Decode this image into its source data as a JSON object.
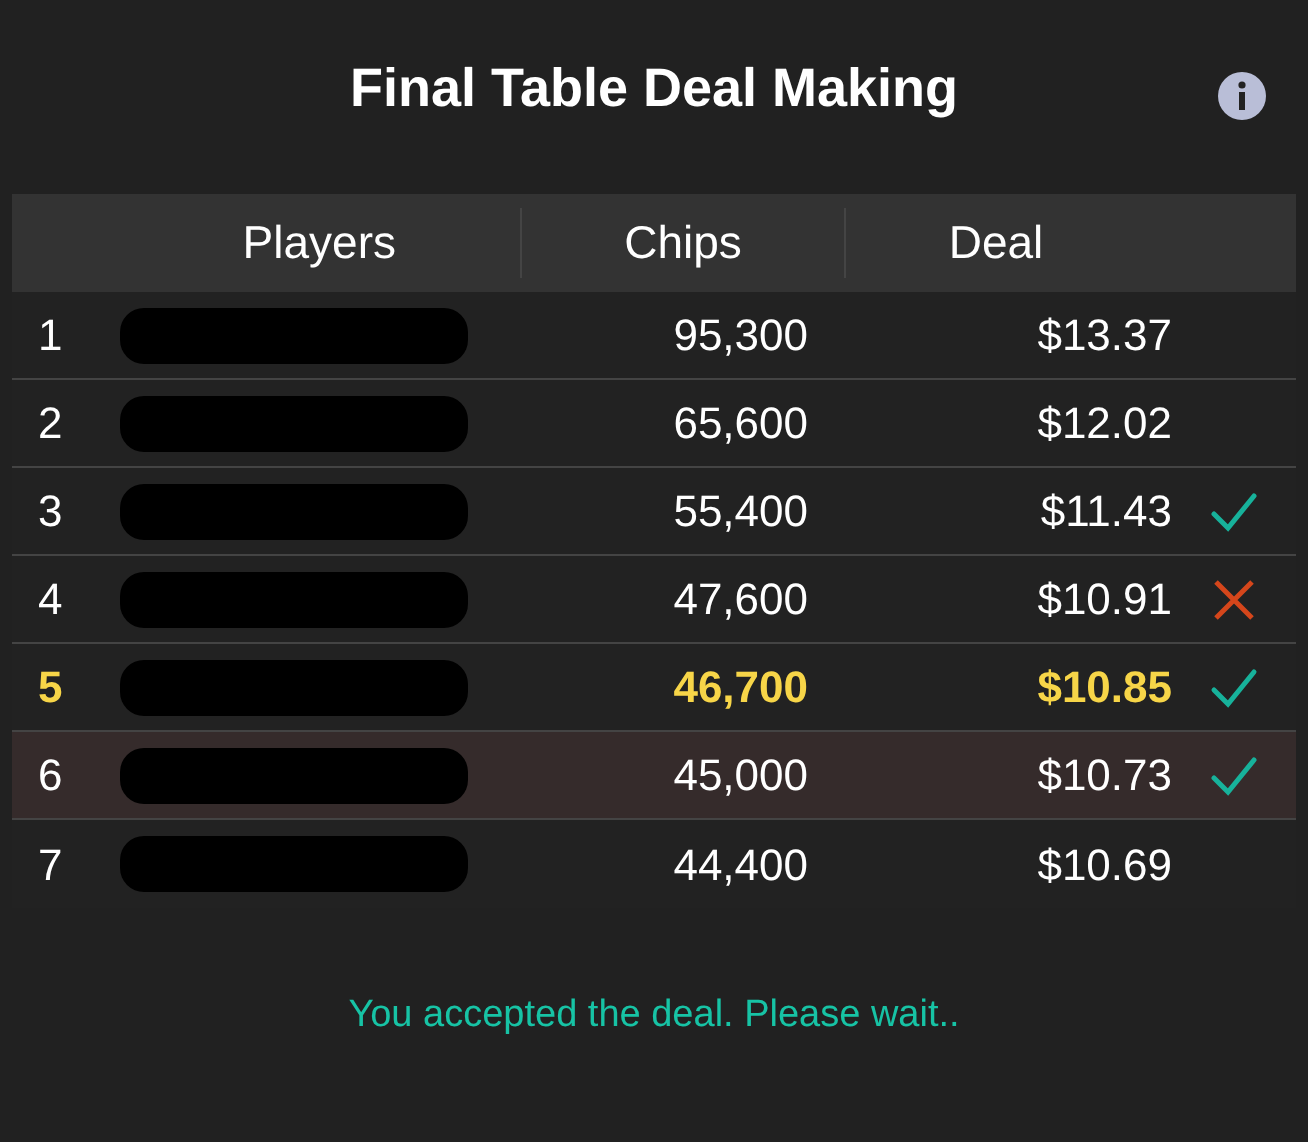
{
  "title": "Final Table Deal Making",
  "table": {
    "columns": [
      "Players",
      "Chips",
      "Deal"
    ],
    "rows": [
      {
        "rank": "1",
        "chips": "95,300",
        "deal": "$13.37",
        "accepted": false,
        "declined": false,
        "current": false,
        "highlighted": false
      },
      {
        "rank": "2",
        "chips": "65,600",
        "deal": "$12.02",
        "accepted": false,
        "declined": false,
        "current": false,
        "highlighted": false
      },
      {
        "rank": "3",
        "chips": "55,400",
        "deal": "$11.43",
        "accepted": true,
        "declined": false,
        "current": false,
        "highlighted": false
      },
      {
        "rank": "4",
        "chips": "47,600",
        "deal": "$10.91",
        "accepted": false,
        "declined": true,
        "current": false,
        "highlighted": false
      },
      {
        "rank": "5",
        "chips": "46,700",
        "deal": "$10.85",
        "accepted": true,
        "declined": false,
        "current": true,
        "highlighted": false
      },
      {
        "rank": "6",
        "chips": "45,000",
        "deal": "$10.73",
        "accepted": true,
        "declined": false,
        "current": false,
        "highlighted": true
      },
      {
        "rank": "7",
        "chips": "44,400",
        "deal": "$10.69",
        "accepted": false,
        "declined": false,
        "current": false,
        "highlighted": false
      }
    ]
  },
  "status_message": "You accepted the deal. Please wait.."
}
